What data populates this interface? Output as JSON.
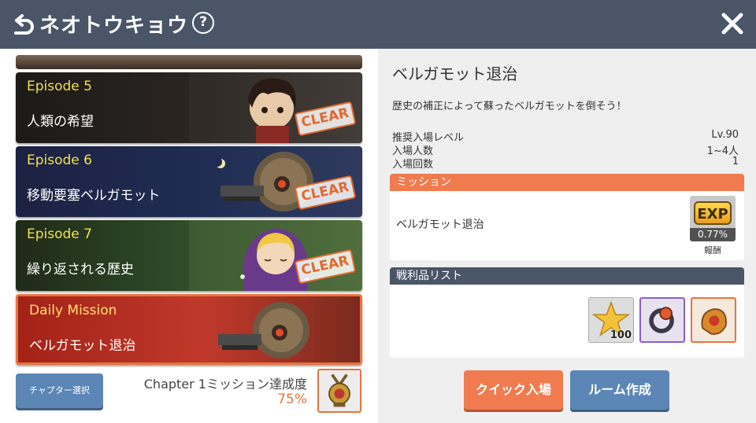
{
  "header": {
    "title": "ネオトウキョウ",
    "help_symbol": "?"
  },
  "episodes": [
    {
      "label": "Episode 5",
      "name": "人類の希望",
      "clear": "CLEAR"
    },
    {
      "label": "Episode 6",
      "name": "移動要塞ベルガモット",
      "clear": "CLEAR"
    },
    {
      "label": "Episode 7",
      "name": "繰り返される歴史",
      "clear": "CLEAR"
    },
    {
      "label": "Daily Mission",
      "name": "ベルガモット退治"
    }
  ],
  "chapter": {
    "select_button": "チャプター選択",
    "progress_label": "Chapter 1ミッション達成度",
    "progress_value": "75%"
  },
  "detail": {
    "title": "ベルガモット退治",
    "description": "歴史の補正によって蘇ったベルガモットを倒そう！",
    "info": [
      {
        "key": "推奨入場レベル",
        "value": "Lv.90"
      },
      {
        "key": "入場人数",
        "value": "1~4人"
      },
      {
        "key": "入場回数",
        "value": "1"
      }
    ],
    "mission": {
      "header": "ミッション",
      "name": "ベルガモット退治",
      "exp_label": "EXP",
      "exp_value": "0.77%",
      "reward_label": "報酬"
    },
    "loot": {
      "header": "戦利品リスト",
      "items": [
        {
          "icon": "star-icon",
          "count": "100"
        },
        {
          "icon": "ring-icon"
        },
        {
          "icon": "medal-icon"
        }
      ]
    },
    "buttons": {
      "quick": "クイック入場",
      "room": "ルーム作成"
    }
  },
  "colors": {
    "header_bg": "#4a5567",
    "accent_orange": "#ef7b4f",
    "accent_blue": "#5b86b6",
    "episode_label": "#f4e04a"
  }
}
